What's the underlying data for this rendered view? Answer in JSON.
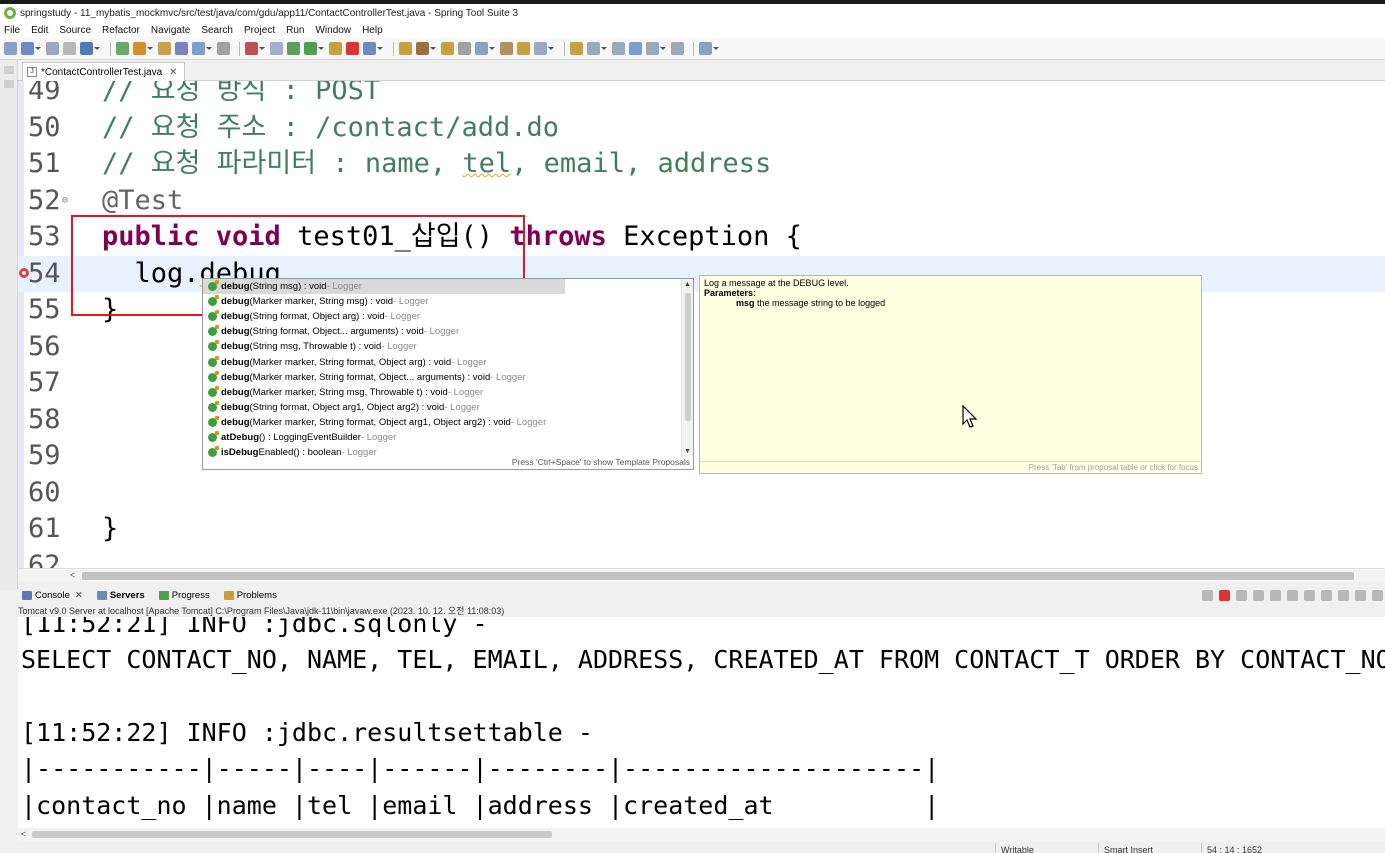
{
  "window": {
    "title": "springstudy - 11_mybatis_mockmvc/src/test/java/com/gdu/app11/ContactControllerTest.java - Spring Tool Suite 3"
  },
  "menu": [
    "File",
    "Edit",
    "Source",
    "Refactor",
    "Navigate",
    "Search",
    "Project",
    "Run",
    "Window",
    "Help"
  ],
  "editor": {
    "tab_label": "*ContactControllerTest.java",
    "lines": [
      {
        "num": "49",
        "segments": [
          {
            "text": "// 요청 방식 : POST",
            "cls": "c-comment"
          }
        ]
      },
      {
        "num": "50",
        "segments": [
          {
            "text": "// 요청 주소 : /contact/add.do",
            "cls": "c-comment"
          }
        ]
      },
      {
        "num": "51",
        "segments": [
          {
            "text": "// 요청 파라미터 : name, ",
            "cls": "c-comment"
          },
          {
            "text": "tel",
            "cls": "c-comment squiggle"
          },
          {
            "text": ", email, address",
            "cls": "c-comment"
          }
        ]
      },
      {
        "num": "52",
        "segments": [
          {
            "text": "@Test",
            "cls": "c-ann"
          }
        ]
      },
      {
        "num": "53",
        "segments": [
          {
            "text": "public void ",
            "cls": "c-kw"
          },
          {
            "text": "test01_삽입() ",
            "cls": "c-plain"
          },
          {
            "text": "throws ",
            "cls": "c-kw"
          },
          {
            "text": "Exception {",
            "cls": "c-plain"
          }
        ]
      },
      {
        "num": "54",
        "segments": [
          {
            "text": "  log.",
            "cls": "c-plain"
          },
          {
            "text": "debug",
            "cls": "c-plain squiggle"
          }
        ]
      },
      {
        "num": "55",
        "segments": [
          {
            "text": "}",
            "cls": "c-plain"
          }
        ]
      },
      {
        "num": "56",
        "segments": []
      },
      {
        "num": "57",
        "segments": []
      },
      {
        "num": "58",
        "segments": []
      },
      {
        "num": "59",
        "segments": []
      },
      {
        "num": "60",
        "segments": []
      },
      {
        "num": "61",
        "segments": [
          {
            "text": "}",
            "cls": "c-plain"
          }
        ]
      },
      {
        "num": "62",
        "segments": []
      }
    ]
  },
  "proposals": {
    "items": [
      {
        "name": "debug",
        "params": "(String msg) : void",
        "source": " - Logger",
        "selected": true
      },
      {
        "name": "debug",
        "params": "(Marker marker, String msg) : void",
        "source": " - Logger"
      },
      {
        "name": "debug",
        "params": "(String format, Object arg) : void",
        "source": " - Logger"
      },
      {
        "name": "debug",
        "params": "(String format, Object... arguments) : void",
        "source": " - Logger"
      },
      {
        "name": "debug",
        "params": "(String msg, Throwable t) : void",
        "source": " - Logger"
      },
      {
        "name": "debug",
        "params": "(Marker marker, String format, Object arg) : void",
        "source": " - Logger"
      },
      {
        "name": "debug",
        "params": "(Marker marker, String format, Object... arguments) : void",
        "source": " - Logger"
      },
      {
        "name": "debug",
        "params": "(Marker marker, String msg, Throwable t) : void",
        "source": " - Logger"
      },
      {
        "name": "debug",
        "params": "(String format, Object arg1, Object arg2) : void",
        "source": " - Logger"
      },
      {
        "name": "debug",
        "params": "(Marker marker, String format, Object arg1, Object arg2) : void",
        "source": " - Logger"
      },
      {
        "name": "atDebug",
        "params": "() : LoggingEventBuilder",
        "source": " - Logger"
      },
      {
        "name": "isDebug",
        "params": "Enabled() : boolean",
        "source": " - Logger"
      }
    ],
    "status": "Press 'Ctrl+Space' to show Template Proposals"
  },
  "javadoc": {
    "description": "Log a message at the DEBUG level.",
    "params_heading": "Parameters:",
    "param_name": "msg",
    "param_desc": " the message string to be logged",
    "status": "Press 'Tab' from proposal table or click for focus"
  },
  "console": {
    "tabs": [
      {
        "label": "Console",
        "closable": true
      },
      {
        "label": "Servers",
        "bold": true
      },
      {
        "label": "Progress"
      },
      {
        "label": "Problems"
      }
    ],
    "header": "Tomcat v9.0 Server at localhost [Apache Tomcat] C:\\Program Files\\Java\\jdk-11\\bin\\javaw.exe  (2023. 10. 12. 오전 11:08:03)",
    "lines": [
      "[11:52:21] INFO :jdbc.sqlonly -",
      "SELECT CONTACT_NO, NAME, TEL, EMAIL, ADDRESS, CREATED_AT FROM CONTACT_T ORDER BY CONTACT_NO DESC",
      "",
      "[11:52:22] INFO :jdbc.resultsettable -",
      "|-----------|-----|----|------|--------|--------------------|",
      "|contact_no |name |tel |email |address |created_at          |",
      "|-----------|-----|----|------|--------|--------------------|"
    ]
  },
  "statusbar": {
    "writable": "Writable",
    "insert_mode": "Smart Insert",
    "position": "54 : 14 : 1652"
  }
}
